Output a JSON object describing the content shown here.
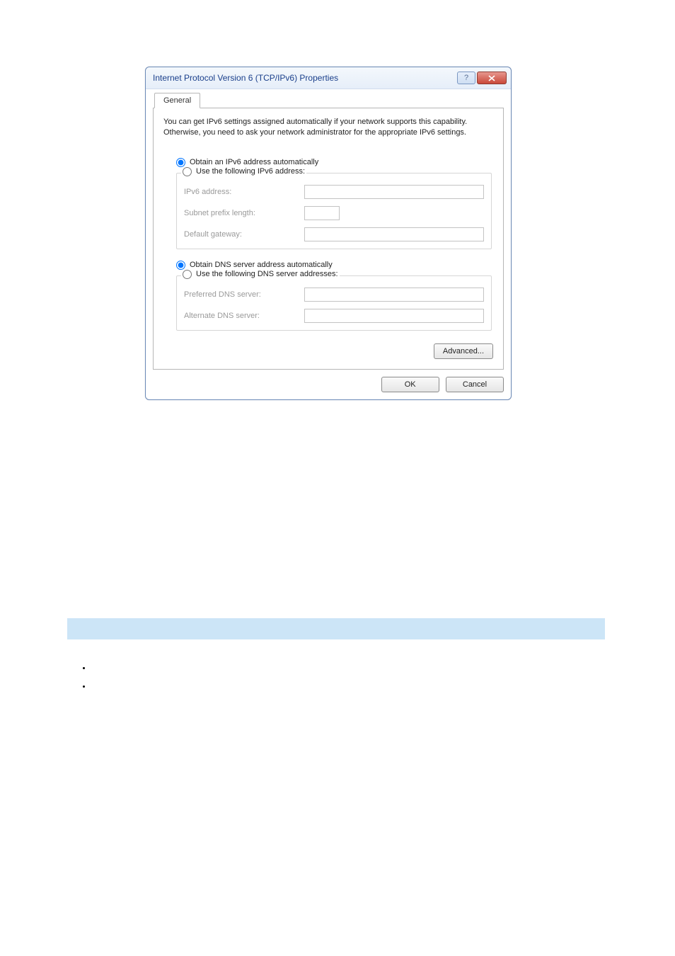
{
  "dialog": {
    "title": "Internet Protocol Version 6 (TCP/IPv6) Properties",
    "tab": "General",
    "description": "You can get IPv6 settings assigned automatically if your network supports this capability. Otherwise, you need to ask your network administrator for the appropriate IPv6 settings.",
    "radio_auto_ip": "Obtain an IPv6 address automatically",
    "radio_use_ip": "Use the following IPv6 address:",
    "ipv6_address_label": "IPv6 address:",
    "subnet_prefix_label": "Subnet prefix length:",
    "default_gateway_label": "Default gateway:",
    "radio_auto_dns": "Obtain DNS server address automatically",
    "radio_use_dns": "Use the following DNS server addresses:",
    "preferred_dns_label": "Preferred DNS server:",
    "alternate_dns_label": "Alternate DNS server:",
    "advanced_button": "Advanced...",
    "ok_button": "OK",
    "cancel_button": "Cancel"
  }
}
